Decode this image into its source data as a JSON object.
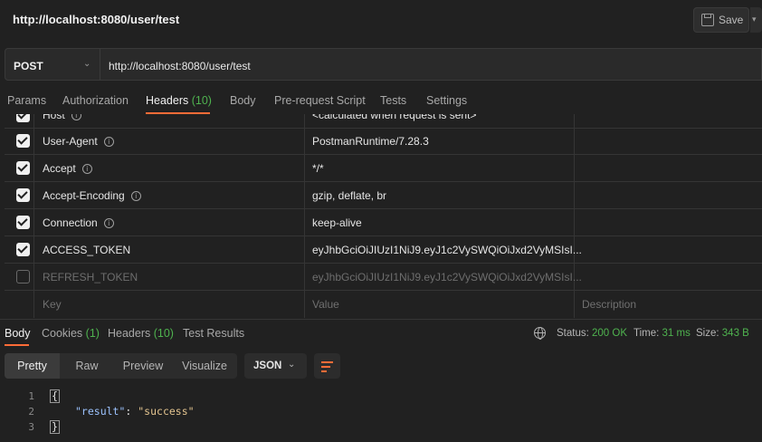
{
  "request": {
    "title": "http://localhost:8080/user/test",
    "save_label": "Save",
    "method": "POST",
    "url": "http://localhost:8080/user/test"
  },
  "request_tabs": [
    {
      "label": "Params"
    },
    {
      "label": "Authorization"
    },
    {
      "label": "Headers",
      "count": "(10)"
    },
    {
      "label": "Body"
    },
    {
      "label": "Pre-request Script"
    },
    {
      "label": "Tests"
    },
    {
      "label": "Settings"
    }
  ],
  "headers": {
    "rows": [
      {
        "key": "Host",
        "value": "<calculated when request is sent>",
        "checked": true
      },
      {
        "key": "User-Agent",
        "value": "PostmanRuntime/7.28.3",
        "checked": true
      },
      {
        "key": "Accept",
        "value": "*/*",
        "checked": true
      },
      {
        "key": "Accept-Encoding",
        "value": "gzip, deflate, br",
        "checked": true
      },
      {
        "key": "Connection",
        "value": "keep-alive",
        "checked": true
      },
      {
        "key": "ACCESS_TOKEN",
        "value": "eyJhbGciOiJIUzI1NiJ9.eyJ1c2VySWQiOiJxd2VyMSIsI...",
        "checked": true
      },
      {
        "key": "REFRESH_TOKEN",
        "value": "eyJhbGciOiJIUzI1NiJ9.eyJ1c2VySWQiOiJxd2VyMSIsI...",
        "checked": false
      }
    ],
    "placeholder": {
      "key": "Key",
      "value": "Value",
      "description": "Description"
    }
  },
  "response_tabs": [
    {
      "label": "Body"
    },
    {
      "label": "Cookies",
      "count": "(1)"
    },
    {
      "label": "Headers",
      "count": "(10)"
    },
    {
      "label": "Test Results"
    }
  ],
  "status": {
    "status_label": "Status:",
    "status_value": "200 OK",
    "time_label": "Time:",
    "time_value": "31 ms",
    "size_label": "Size:",
    "size_value": "343 B"
  },
  "view_tabs": [
    "Pretty",
    "Raw",
    "Preview",
    "Visualize"
  ],
  "format": "JSON",
  "code": {
    "line_numbers": [
      "1",
      "2",
      "3"
    ],
    "open_brace": "{",
    "key": "\"result\"",
    "colon": ": ",
    "value": "\"success\"",
    "close_brace": "}"
  },
  "colors": {
    "accent": "#ff6c37",
    "success": "#4fb34f",
    "background": "#212121"
  },
  "icons": [
    "save-icon",
    "chevron-down-icon",
    "info-icon",
    "checkbox-icon",
    "globe-icon",
    "wrap-lines-icon"
  ]
}
